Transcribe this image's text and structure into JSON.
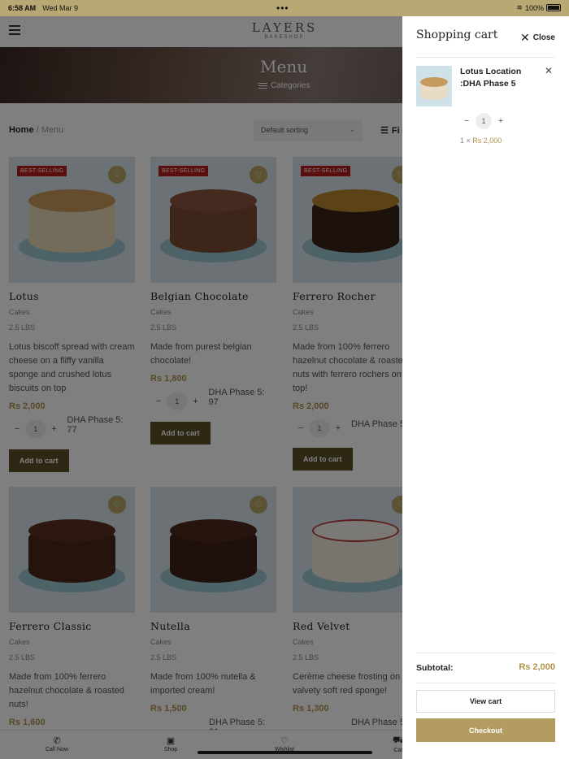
{
  "status": {
    "time": "6:58 AM",
    "date": "Wed Mar 9",
    "battery": "100%"
  },
  "header": {
    "logo_main": "LAYERS",
    "logo_sub": "BAKESHOP"
  },
  "hero": {
    "title": "Menu",
    "categories_label": "Categories"
  },
  "breadcrumb": {
    "home": "Home",
    "separator": "/",
    "current": "Menu"
  },
  "toolbar": {
    "sort_label": "Default sorting",
    "filter_label": "Fi"
  },
  "badge_text": "BEST-SELLING",
  "products": [
    {
      "name": "Lotus",
      "category": "Cakes",
      "size": "2.5 LBS",
      "desc": "Lotus biscoff spread with cream cheese on a fliffy vanilla sponge and crushed lotus biscuits on top",
      "price": "Rs 2,000",
      "qty": "1",
      "location": "DHA Phase 5: 77",
      "add_label": "Add to cart",
      "color": "#e9d8b6",
      "top": "#c9985a"
    },
    {
      "name": "Belgian Chocolate",
      "category": "Cakes",
      "size": "2.5 LBS",
      "desc": "Made from purest belgian chocolate!",
      "price": "Rs 1,800",
      "qty": "1",
      "location": "DHA Phase 5: 97",
      "add_label": "Add to cart",
      "color": "#7a4a35",
      "top": "#8a563f"
    },
    {
      "name": "Ferrero Rocher",
      "category": "Cakes",
      "size": "2.5 LBS",
      "desc": "Made from 100% ferrero hazelnut chocolate & roaste nuts with ferrero rochers on top!",
      "price": "Rs 2,000",
      "qty": "1",
      "location": "DHA Phase 5",
      "add_label": "Add to cart",
      "color": "#3a2218",
      "top": "#b8862e"
    },
    {
      "name": "Ferrero Classic",
      "category": "Cakes",
      "size": "2.5 LBS",
      "desc": "Made from 100% ferrero hazelnut chocolate & roasted nuts!",
      "price": "Rs 1,600",
      "color": "#4a271c",
      "top": "#5a3022"
    },
    {
      "name": "Nutella",
      "category": "Cakes",
      "size": "2.5 LBS",
      "desc": "Made from 100% nutella & imported cream!",
      "price": "Rs 1,500",
      "location": "DHA Phase 5: 91",
      "color": "#3e2016",
      "top": "#4d2a1d"
    },
    {
      "name": "Red Velvet",
      "category": "Cakes",
      "size": "2.5 LBS",
      "desc": "Cerème cheese frosting on valvety soft red sponge!",
      "price": "Rs 1,300",
      "location": "DHA Phase 5",
      "color": "#f0eadf",
      "top": "#f6f2ea"
    }
  ],
  "bottom_nav": {
    "call": "Call Now",
    "shop": "Shop",
    "wishlist": "Wishlist",
    "cart": "Car"
  },
  "cart": {
    "title": "Shopping cart",
    "close_label": "Close",
    "item": {
      "name": "Lotus Location :DHA Phase 5",
      "qty": "1",
      "line_qty": "1 ×",
      "line_price": "Rs 2,000"
    },
    "subtotal_label": "Subtotal:",
    "subtotal_value": "Rs 2,000",
    "view_cart_label": "View cart",
    "checkout_label": "Checkout"
  },
  "colors": {
    "accent": "#b39c5f",
    "price": "#b0924c",
    "badge": "#b91d1d",
    "dark_button": "#5b4e26"
  }
}
